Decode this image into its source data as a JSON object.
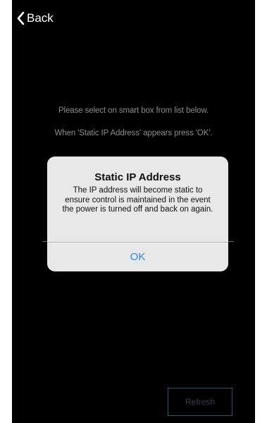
{
  "nav": {
    "back_label": "Back",
    "back_icon": "chevron-left-icon"
  },
  "instructions": {
    "line1": "Please select on smart box from list below.",
    "line2": "When 'Static IP Address' appears press 'OK'."
  },
  "alert": {
    "title": "Static IP Address",
    "message": "The IP address will become static to ensure control is maintained in the event the power is turned off and back on again.",
    "ok_label": "OK"
  },
  "footer": {
    "refresh_label": "Refresh"
  },
  "colors": {
    "background": "#000000",
    "alert_background": "#e8e8e8",
    "accent_blue": "#2f86d9",
    "instruction_text": "#8a8a8a",
    "refresh_border": "#27556a"
  }
}
